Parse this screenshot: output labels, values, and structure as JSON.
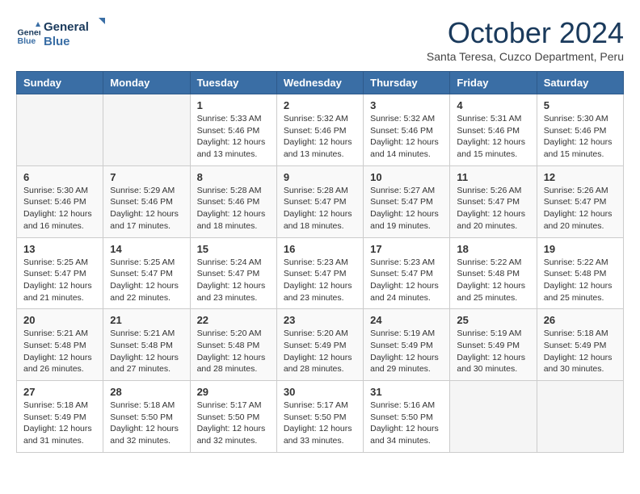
{
  "logo": {
    "line1": "General",
    "line2": "Blue"
  },
  "title": "October 2024",
  "subtitle": "Santa Teresa, Cuzco Department, Peru",
  "weekdays": [
    "Sunday",
    "Monday",
    "Tuesday",
    "Wednesday",
    "Thursday",
    "Friday",
    "Saturday"
  ],
  "weeks": [
    [
      {
        "day": "",
        "info": ""
      },
      {
        "day": "",
        "info": ""
      },
      {
        "day": "1",
        "info": "Sunrise: 5:33 AM\nSunset: 5:46 PM\nDaylight: 12 hours\nand 13 minutes."
      },
      {
        "day": "2",
        "info": "Sunrise: 5:32 AM\nSunset: 5:46 PM\nDaylight: 12 hours\nand 13 minutes."
      },
      {
        "day": "3",
        "info": "Sunrise: 5:32 AM\nSunset: 5:46 PM\nDaylight: 12 hours\nand 14 minutes."
      },
      {
        "day": "4",
        "info": "Sunrise: 5:31 AM\nSunset: 5:46 PM\nDaylight: 12 hours\nand 15 minutes."
      },
      {
        "day": "5",
        "info": "Sunrise: 5:30 AM\nSunset: 5:46 PM\nDaylight: 12 hours\nand 15 minutes."
      }
    ],
    [
      {
        "day": "6",
        "info": "Sunrise: 5:30 AM\nSunset: 5:46 PM\nDaylight: 12 hours\nand 16 minutes."
      },
      {
        "day": "7",
        "info": "Sunrise: 5:29 AM\nSunset: 5:46 PM\nDaylight: 12 hours\nand 17 minutes."
      },
      {
        "day": "8",
        "info": "Sunrise: 5:28 AM\nSunset: 5:46 PM\nDaylight: 12 hours\nand 18 minutes."
      },
      {
        "day": "9",
        "info": "Sunrise: 5:28 AM\nSunset: 5:47 PM\nDaylight: 12 hours\nand 18 minutes."
      },
      {
        "day": "10",
        "info": "Sunrise: 5:27 AM\nSunset: 5:47 PM\nDaylight: 12 hours\nand 19 minutes."
      },
      {
        "day": "11",
        "info": "Sunrise: 5:26 AM\nSunset: 5:47 PM\nDaylight: 12 hours\nand 20 minutes."
      },
      {
        "day": "12",
        "info": "Sunrise: 5:26 AM\nSunset: 5:47 PM\nDaylight: 12 hours\nand 20 minutes."
      }
    ],
    [
      {
        "day": "13",
        "info": "Sunrise: 5:25 AM\nSunset: 5:47 PM\nDaylight: 12 hours\nand 21 minutes."
      },
      {
        "day": "14",
        "info": "Sunrise: 5:25 AM\nSunset: 5:47 PM\nDaylight: 12 hours\nand 22 minutes."
      },
      {
        "day": "15",
        "info": "Sunrise: 5:24 AM\nSunset: 5:47 PM\nDaylight: 12 hours\nand 23 minutes."
      },
      {
        "day": "16",
        "info": "Sunrise: 5:23 AM\nSunset: 5:47 PM\nDaylight: 12 hours\nand 23 minutes."
      },
      {
        "day": "17",
        "info": "Sunrise: 5:23 AM\nSunset: 5:47 PM\nDaylight: 12 hours\nand 24 minutes."
      },
      {
        "day": "18",
        "info": "Sunrise: 5:22 AM\nSunset: 5:48 PM\nDaylight: 12 hours\nand 25 minutes."
      },
      {
        "day": "19",
        "info": "Sunrise: 5:22 AM\nSunset: 5:48 PM\nDaylight: 12 hours\nand 25 minutes."
      }
    ],
    [
      {
        "day": "20",
        "info": "Sunrise: 5:21 AM\nSunset: 5:48 PM\nDaylight: 12 hours\nand 26 minutes."
      },
      {
        "day": "21",
        "info": "Sunrise: 5:21 AM\nSunset: 5:48 PM\nDaylight: 12 hours\nand 27 minutes."
      },
      {
        "day": "22",
        "info": "Sunrise: 5:20 AM\nSunset: 5:48 PM\nDaylight: 12 hours\nand 28 minutes."
      },
      {
        "day": "23",
        "info": "Sunrise: 5:20 AM\nSunset: 5:49 PM\nDaylight: 12 hours\nand 28 minutes."
      },
      {
        "day": "24",
        "info": "Sunrise: 5:19 AM\nSunset: 5:49 PM\nDaylight: 12 hours\nand 29 minutes."
      },
      {
        "day": "25",
        "info": "Sunrise: 5:19 AM\nSunset: 5:49 PM\nDaylight: 12 hours\nand 30 minutes."
      },
      {
        "day": "26",
        "info": "Sunrise: 5:18 AM\nSunset: 5:49 PM\nDaylight: 12 hours\nand 30 minutes."
      }
    ],
    [
      {
        "day": "27",
        "info": "Sunrise: 5:18 AM\nSunset: 5:49 PM\nDaylight: 12 hours\nand 31 minutes."
      },
      {
        "day": "28",
        "info": "Sunrise: 5:18 AM\nSunset: 5:50 PM\nDaylight: 12 hours\nand 32 minutes."
      },
      {
        "day": "29",
        "info": "Sunrise: 5:17 AM\nSunset: 5:50 PM\nDaylight: 12 hours\nand 32 minutes."
      },
      {
        "day": "30",
        "info": "Sunrise: 5:17 AM\nSunset: 5:50 PM\nDaylight: 12 hours\nand 33 minutes."
      },
      {
        "day": "31",
        "info": "Sunrise: 5:16 AM\nSunset: 5:50 PM\nDaylight: 12 hours\nand 34 minutes."
      },
      {
        "day": "",
        "info": ""
      },
      {
        "day": "",
        "info": ""
      }
    ]
  ]
}
